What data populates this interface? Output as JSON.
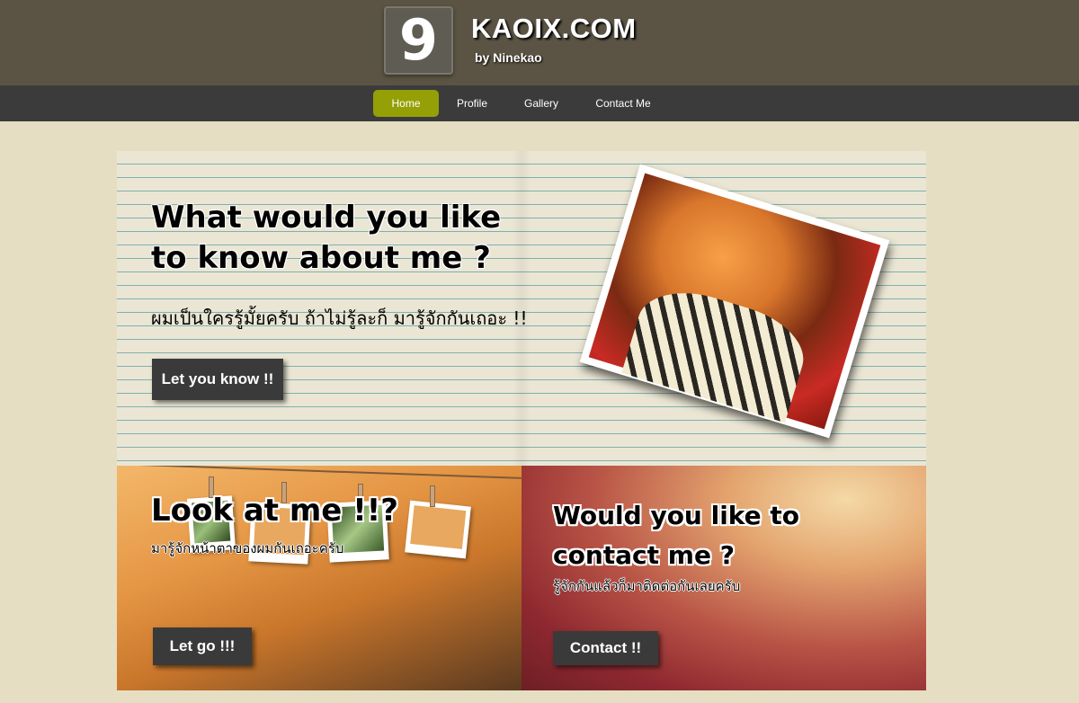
{
  "header": {
    "logo_number": "9",
    "site_title": "KAOIX.COM",
    "site_subtitle": "by Ninekao"
  },
  "nav": {
    "items": [
      {
        "label": "Home",
        "active": true
      },
      {
        "label": "Profile",
        "active": false
      },
      {
        "label": "Gallery",
        "active": false
      },
      {
        "label": "Contact Me",
        "active": false
      }
    ]
  },
  "hero": {
    "title_line1": "What would you like",
    "title_line2": "to know about me ?",
    "subtitle": "ผมเป็นใครรู้มั้ยครับ ถ้าไม่รู้ละก็ มารู้จักกันเถอะ !!",
    "button_label": "Let you know !!"
  },
  "gallery_card": {
    "title": "Look at me !!?",
    "subtitle": "มารู้จักหน้าตาของผมกันเถอะครับ",
    "button_label": "Let go !!!"
  },
  "contact_card": {
    "title_line1": "Would you like to",
    "title_line2": "contact me ?",
    "subtitle": "รู้จักกันแล้วก็มาติดต่อกันเลยครับ",
    "button_label": "Contact !!"
  },
  "colors": {
    "header_bg": "#5b5444",
    "nav_bg": "#3c3b3c",
    "nav_active": "#94a005",
    "page_bg": "#e6dec2",
    "button_bg": "#3a3a3a"
  }
}
